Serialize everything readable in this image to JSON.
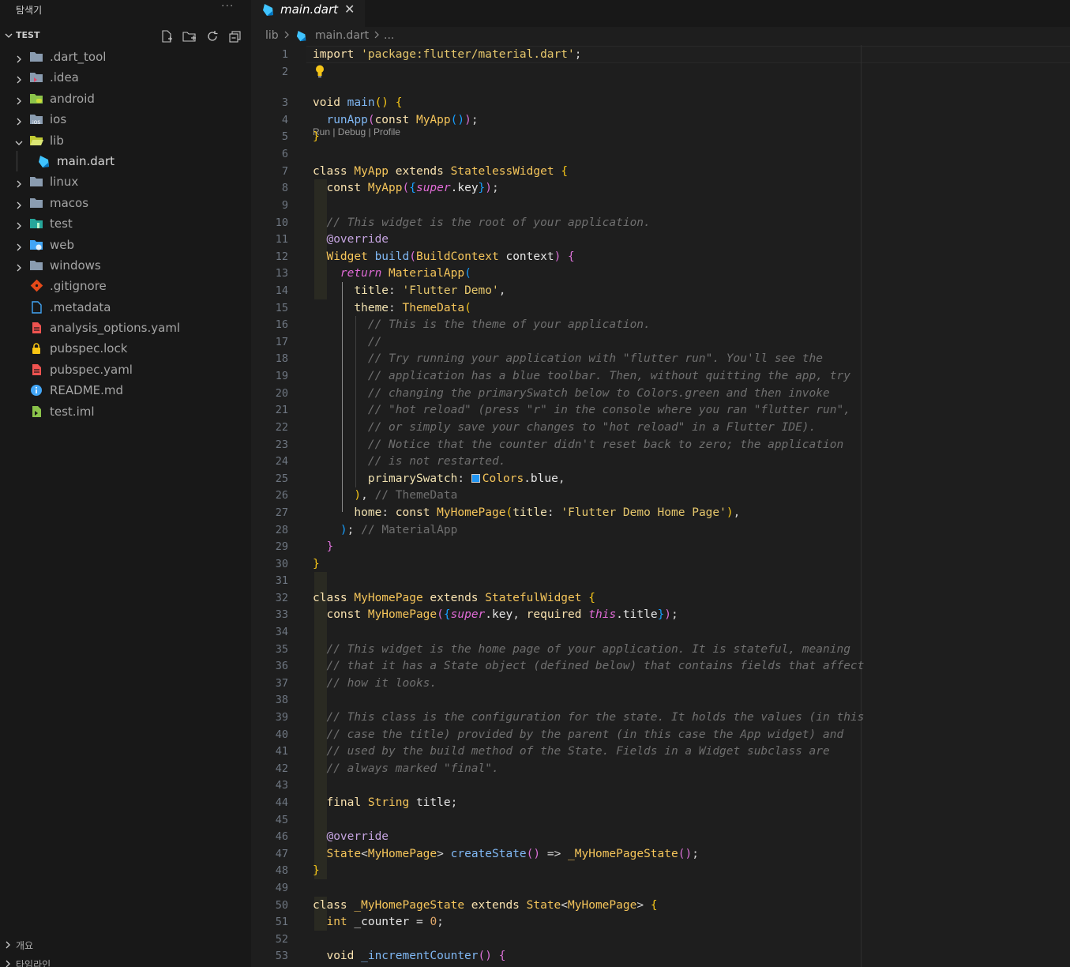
{
  "sidebar": {
    "title": "탐색기",
    "more": "···",
    "project": "TEST",
    "items": [
      {
        "label": ".dart_tool",
        "icon": "folder-icon",
        "expanded": false
      },
      {
        "label": ".idea",
        "icon": "folder-idea-icon",
        "expanded": false
      },
      {
        "label": "android",
        "icon": "folder-android-icon",
        "expanded": false
      },
      {
        "label": "ios",
        "icon": "folder-ios-icon",
        "expanded": false
      },
      {
        "label": "lib",
        "icon": "folder-open-icon",
        "expanded": true
      },
      {
        "label": "main.dart",
        "icon": "dart-icon",
        "child": true
      },
      {
        "label": "linux",
        "icon": "folder-icon",
        "expanded": false
      },
      {
        "label": "macos",
        "icon": "folder-icon",
        "expanded": false
      },
      {
        "label": "test",
        "icon": "folder-test-icon",
        "expanded": false
      },
      {
        "label": "web",
        "icon": "folder-web-icon",
        "expanded": false
      },
      {
        "label": "windows",
        "icon": "folder-icon",
        "expanded": false
      },
      {
        "label": ".gitignore",
        "icon": "git-icon"
      },
      {
        "label": ".metadata",
        "icon": "file-icon"
      },
      {
        "label": "analysis_options.yaml",
        "icon": "yaml-icon"
      },
      {
        "label": "pubspec.lock",
        "icon": "lock-icon"
      },
      {
        "label": "pubspec.yaml",
        "icon": "yaml-icon"
      },
      {
        "label": "README.md",
        "icon": "info-icon"
      },
      {
        "label": "test.iml",
        "icon": "iml-icon"
      }
    ],
    "outline_label": "개요",
    "timeline_label": "타임라인"
  },
  "tab": {
    "label": "main.dart",
    "close": "✕"
  },
  "breadcrumb": {
    "folder": "lib",
    "file": "main.dart",
    "more": "..."
  },
  "codelens": "Run | Debug | Profile",
  "colors": {
    "accent": "#0078d4",
    "bg": "#1e1e1e",
    "sidebar": "#181818"
  }
}
